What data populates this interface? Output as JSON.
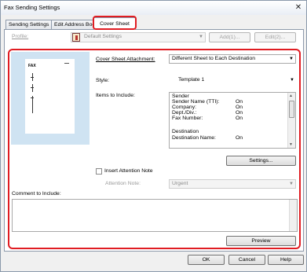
{
  "window": {
    "title": "Fax Sending Settings",
    "close_glyph": "✕"
  },
  "tabs": [
    {
      "label": "Sending Settings"
    },
    {
      "label": "Edit Address Boo"
    },
    {
      "label": "Cover Sheet"
    }
  ],
  "profile": {
    "label": "Profile:",
    "value": "Default Settings",
    "add_label": "Add(1)...",
    "edit_label": "Edit(2)..."
  },
  "preview": {
    "fax_text": "FAX"
  },
  "cover_attachment": {
    "label": "Cover Sheet Attachment:",
    "value": "Different Sheet to Each Destination"
  },
  "style": {
    "label": "Style:",
    "value": "Template 1"
  },
  "items_to_include": {
    "label": "Items to Include:",
    "rows": [
      {
        "name": "Sender",
        "value": ""
      },
      {
        "name": "Sender Name (TTI):",
        "value": "On"
      },
      {
        "name": "Company:",
        "value": "On"
      },
      {
        "name": "Dept./Div.:",
        "value": "On"
      },
      {
        "name": "Fax Number:",
        "value": "On"
      },
      {
        "name": "",
        "value": ""
      },
      {
        "name": "Destination",
        "value": ""
      },
      {
        "name": "Destination Name:",
        "value": "On"
      }
    ]
  },
  "settings_button": "Settings...",
  "attention_note": {
    "checkbox_label": "Insert Attention Note",
    "label": "Attention Note:",
    "value": "Urgent"
  },
  "comment": {
    "label": "Comment to Include:",
    "value": ""
  },
  "preview_button": "Preview",
  "footer": {
    "ok": "OK",
    "cancel": "Cancel",
    "help": "Help"
  },
  "colors": {
    "highlight_red": "#e01c22",
    "preview_bg": "#cfe3f2"
  }
}
